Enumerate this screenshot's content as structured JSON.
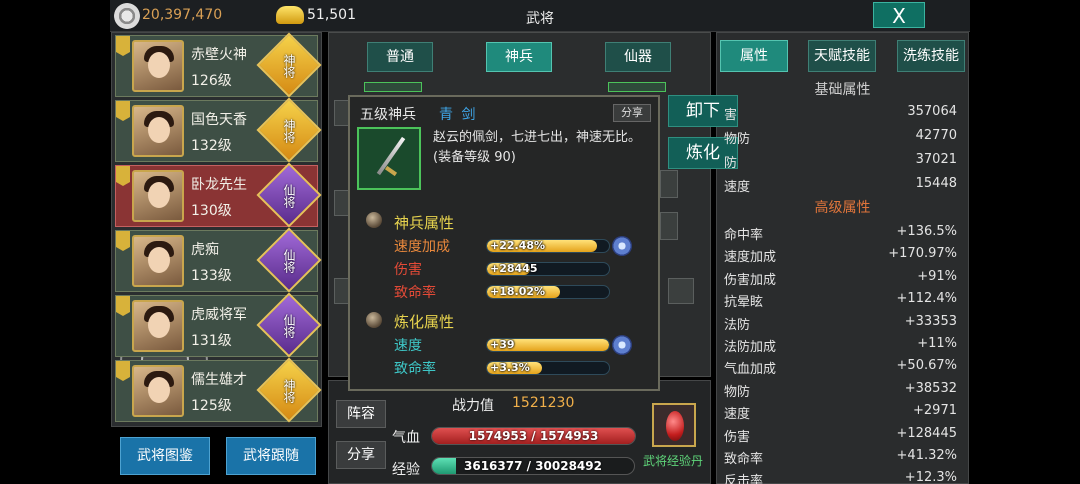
{
  "topbar": {
    "silver": "20,397,470",
    "gold": "51,501",
    "title": "武将",
    "close_label": "X"
  },
  "heroes": [
    {
      "name": "赤壁火神",
      "level": "126级",
      "rank": "神将",
      "rank_type": "shen",
      "selected": false
    },
    {
      "name": "国色天香",
      "level": "132级",
      "rank": "神将",
      "rank_type": "shen",
      "selected": false
    },
    {
      "name": "卧龙先生",
      "level": "130级",
      "rank": "仙将",
      "rank_type": "xian",
      "selected": true
    },
    {
      "name": "虎痴",
      "level": "133级",
      "rank": "仙将",
      "rank_type": "xian",
      "selected": false
    },
    {
      "name": "虎威将军",
      "level": "131级",
      "rank": "仙将",
      "rank_type": "xian",
      "selected": false
    },
    {
      "name": "儒生雄才",
      "level": "125级",
      "rank": "神将",
      "rank_type": "shen",
      "selected": false
    }
  ],
  "bottom_buttons": {
    "codex": "武将图鉴",
    "follow": "武将跟随"
  },
  "center_tabs": [
    "普通",
    "神兵",
    "仙器"
  ],
  "center_active_tab": "神兵",
  "info": {
    "lineup": "阵容",
    "share": "分享",
    "power_label": "战力值",
    "power_value": "1521230",
    "hp_label": "气血",
    "hp_text": "1574953 / 1574953",
    "hp_ratio": 1.0,
    "exp_label": "经验",
    "exp_text": "3616377 / 30028492",
    "exp_ratio": 0.12,
    "exp_item_label": "武将经验丹"
  },
  "right": {
    "tabs": [
      "属性",
      "天赋技能",
      "洗练技能"
    ],
    "active_tab": "属性",
    "base_title": "基础属性",
    "base_stats": [
      {
        "name": "害",
        "value": "357064"
      },
      {
        "name": "物防",
        "value": "42770"
      },
      {
        "name": "防",
        "value": "37021"
      },
      {
        "name": "速度",
        "value": "15448"
      }
    ],
    "adv_title": "高级属性",
    "adv_stats": [
      {
        "name": "命中率",
        "value": "+136.5%"
      },
      {
        "name": "速度加成",
        "value": "+170.97%"
      },
      {
        "name": "伤害加成",
        "value": "+91%"
      },
      {
        "name": "抗晕眩",
        "value": "+112.4%"
      },
      {
        "name": "法防",
        "value": "+33353"
      },
      {
        "name": "法防加成",
        "value": "+11%"
      },
      {
        "name": "气血加成",
        "value": "+50.67%"
      },
      {
        "name": "物防",
        "value": "+38532"
      },
      {
        "name": "速度",
        "value": "+2971"
      },
      {
        "name": "伤害",
        "value": "+128445"
      },
      {
        "name": "致命率",
        "value": "+41.32%"
      },
      {
        "name": "反击率",
        "value": "+12.3%"
      }
    ]
  },
  "popup": {
    "grade": "五级神兵",
    "name": "青 剑",
    "share": "分享",
    "desc": "赵云的佩剑，七进七出，神速无比。(装备等级 90)",
    "sect1_title": "神兵属性",
    "sect1": [
      {
        "name": "速度加成",
        "value": "+22.48%",
        "ratio": 0.9,
        "color": "orange",
        "star": true
      },
      {
        "name": "伤害",
        "value": "+28445",
        "ratio": 0.35,
        "color": "red",
        "star": false
      },
      {
        "name": "致命率",
        "value": "+18.02%",
        "ratio": 0.6,
        "color": "red",
        "star": false
      }
    ],
    "sect2_title": "炼化属性",
    "sect2": [
      {
        "name": "速度",
        "value": "+39",
        "ratio": 1.0,
        "color": "cyan",
        "star": true
      },
      {
        "name": "致命率",
        "value": "+3.3%",
        "ratio": 0.45,
        "color": "cyan",
        "star": false
      }
    ],
    "unequip": "卸下",
    "refine": "炼化"
  }
}
